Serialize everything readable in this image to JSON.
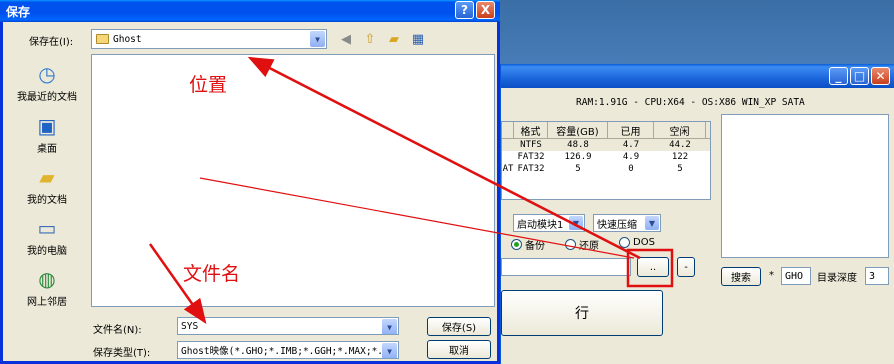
{
  "bg_window": {
    "sysinfo": "RAM:1.91G - CPU:X64 - OS:X86 WIN_XP SATA",
    "table": {
      "headers": [
        "",
        "格式",
        "容量(GB)",
        "已用",
        "空闲"
      ],
      "rows": [
        [
          "",
          "NTFS",
          "48.8",
          "4.7",
          "44.2"
        ],
        [
          "",
          "FAT32",
          "126.9",
          "4.9",
          "122"
        ],
        [
          "AT",
          "FAT32",
          "5",
          "0",
          "5"
        ]
      ]
    },
    "mode_combo": "启动模块1",
    "compress_combo": "快速压缩",
    "radios": [
      {
        "label": "备份",
        "checked": true
      },
      {
        "label": "还原",
        "checked": false
      },
      {
        "label": "DOS",
        "checked": false
      }
    ],
    "browse_label": "..",
    "minus_label": "-",
    "run_label": "行",
    "search_button": "搜索",
    "star": "*",
    "ext_value": "GHO",
    "depth_label": "目录深度",
    "depth_value": "3"
  },
  "dialog": {
    "title": "保存",
    "help_btn": "?",
    "close_btn": "X",
    "save_in_label": "保存在(I):",
    "location": "Ghost",
    "places": [
      {
        "label": "我最近的文档",
        "icon": "recent-documents-icon"
      },
      {
        "label": "桌面",
        "icon": "desktop-icon"
      },
      {
        "label": "我的文档",
        "icon": "my-documents-icon"
      },
      {
        "label": "我的电脑",
        "icon": "my-computer-icon"
      },
      {
        "label": "网上邻居",
        "icon": "network-places-icon"
      }
    ],
    "filename_label": "文件名(N):",
    "filename_value": "SYS",
    "filetype_label": "保存类型(T):",
    "filetype_value": "Ghost映像(*.GHO;*.IMB;*.GGH;*.MAX;*.f",
    "save_button": "保存(S)",
    "cancel_button": "取消"
  },
  "annotations": {
    "location_note": "位置",
    "filename_note": "文件名"
  },
  "colors": {
    "annotation": "#e01010"
  }
}
